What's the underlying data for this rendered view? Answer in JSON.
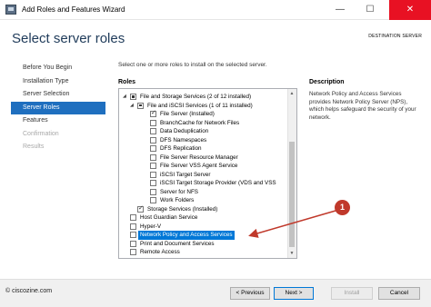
{
  "window": {
    "title": "Add Roles and Features Wizard",
    "minimize": "—",
    "maximize": "☐",
    "close": "✕"
  },
  "header": {
    "page_title": "Select server roles",
    "destination_label": "DESTINATION SERVER",
    "destination_value": ""
  },
  "nav": {
    "items": [
      {
        "label": "Before You Begin",
        "state": "normal"
      },
      {
        "label": "Installation Type",
        "state": "normal"
      },
      {
        "label": "Server Selection",
        "state": "normal"
      },
      {
        "label": "Server Roles",
        "state": "active"
      },
      {
        "label": "Features",
        "state": "normal"
      },
      {
        "label": "Confirmation",
        "state": "disabled"
      },
      {
        "label": "Results",
        "state": "disabled"
      }
    ]
  },
  "main": {
    "instruction": "Select one or more roles to install on the selected server.",
    "roles_label": "Roles",
    "description_label": "Description",
    "description_text": "Network Policy and Access Services provides Network Policy Server (NPS), which helps safeguard the security of your network.",
    "roles": [
      {
        "label": "File and Storage Services (2 of 12 installed)",
        "checkbox": "partial",
        "expander": "◢"
      },
      {
        "label": "File and iSCSI Services (1 of 11 installed)",
        "checkbox": "partial",
        "expander": "◢"
      },
      {
        "label": "File Server (Installed)",
        "checkbox": "checked",
        "expander": ""
      },
      {
        "label": "BranchCache for Network Files",
        "checkbox": "unchecked",
        "expander": ""
      },
      {
        "label": "Data Deduplication",
        "checkbox": "unchecked",
        "expander": ""
      },
      {
        "label": "DFS Namespaces",
        "checkbox": "unchecked",
        "expander": ""
      },
      {
        "label": "DFS Replication",
        "checkbox": "unchecked",
        "expander": ""
      },
      {
        "label": "File Server Resource Manager",
        "checkbox": "unchecked",
        "expander": ""
      },
      {
        "label": "File Server VSS Agent Service",
        "checkbox": "unchecked",
        "expander": ""
      },
      {
        "label": "iSCSI Target Server",
        "checkbox": "unchecked",
        "expander": ""
      },
      {
        "label": "iSCSI Target Storage Provider (VDS and VSS",
        "checkbox": "unchecked",
        "expander": ""
      },
      {
        "label": "Server for NFS",
        "checkbox": "unchecked",
        "expander": ""
      },
      {
        "label": "Work Folders",
        "checkbox": "unchecked",
        "expander": ""
      },
      {
        "label": "Storage Services (Installed)",
        "checkbox": "checked",
        "expander": ""
      },
      {
        "label": "Host Guardian Service",
        "checkbox": "unchecked",
        "expander": ""
      },
      {
        "label": "Hyper-V",
        "checkbox": "unchecked",
        "expander": ""
      },
      {
        "label": "Network Policy and Access Services",
        "checkbox": "unchecked",
        "expander": "",
        "selected": true
      },
      {
        "label": "Print and Document Services",
        "checkbox": "unchecked",
        "expander": ""
      },
      {
        "label": "Remote Access",
        "checkbox": "unchecked",
        "expander": ""
      }
    ]
  },
  "annotation": {
    "callout_number": "1",
    "color": "#c0392b"
  },
  "footer": {
    "watermark": "© ciscozine.com",
    "previous": "< Previous",
    "next": "Next >",
    "install": "Install",
    "cancel": "Cancel"
  },
  "colors": {
    "accent": "#1f6fbf",
    "selection": "#0078d7",
    "title": "#1f3b5a"
  }
}
